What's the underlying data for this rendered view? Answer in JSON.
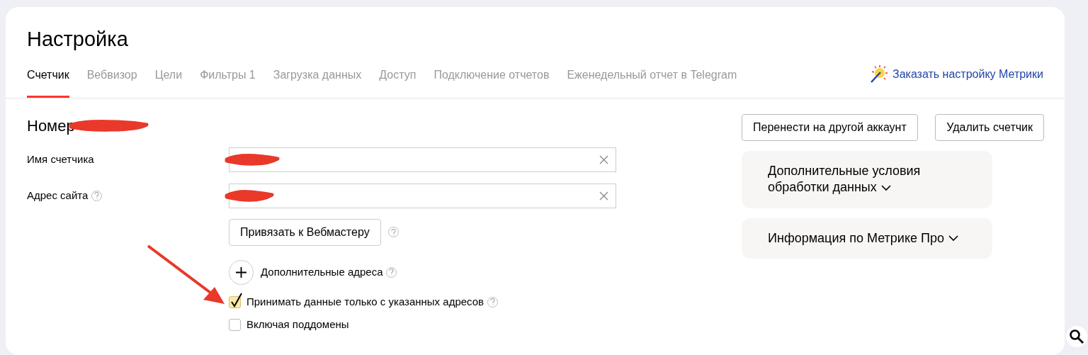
{
  "title": "Настройка",
  "tabs": [
    {
      "label": "Счетчик",
      "selected": true
    },
    {
      "label": "Вебвизор",
      "selected": false
    },
    {
      "label": "Цели",
      "selected": false
    },
    {
      "label": "Фильтры 1",
      "selected": false
    },
    {
      "label": "Загрузка данных",
      "selected": false
    },
    {
      "label": "Доступ",
      "selected": false
    },
    {
      "label": "Подключение отчетов",
      "selected": false
    },
    {
      "label": "Еженедельный отчет в Telegram",
      "selected": false
    }
  ],
  "promo_link": "Заказать настройку Метрики",
  "counter_heading": "Номер",
  "fields": [
    {
      "label": "Имя счетчика",
      "help": false
    },
    {
      "label": "Адрес сайта",
      "help": true
    }
  ],
  "webmaster_button": "Привязать к Вебмастеру",
  "additional_addresses": "Дополнительные адреса",
  "checkboxes": [
    {
      "label": "Принимать данные только с указанных адресов",
      "checked": true,
      "help": true
    },
    {
      "label": "Включая поддомены",
      "checked": false,
      "help": false
    }
  ],
  "actions": [
    "Перенести на другой аккаунт",
    "Удалить счетчик"
  ],
  "panels": [
    {
      "title": "Дополнительные условия обработки данных",
      "expanded": false
    },
    {
      "title": "Информация по Метрике Про",
      "expanded": false
    }
  ]
}
